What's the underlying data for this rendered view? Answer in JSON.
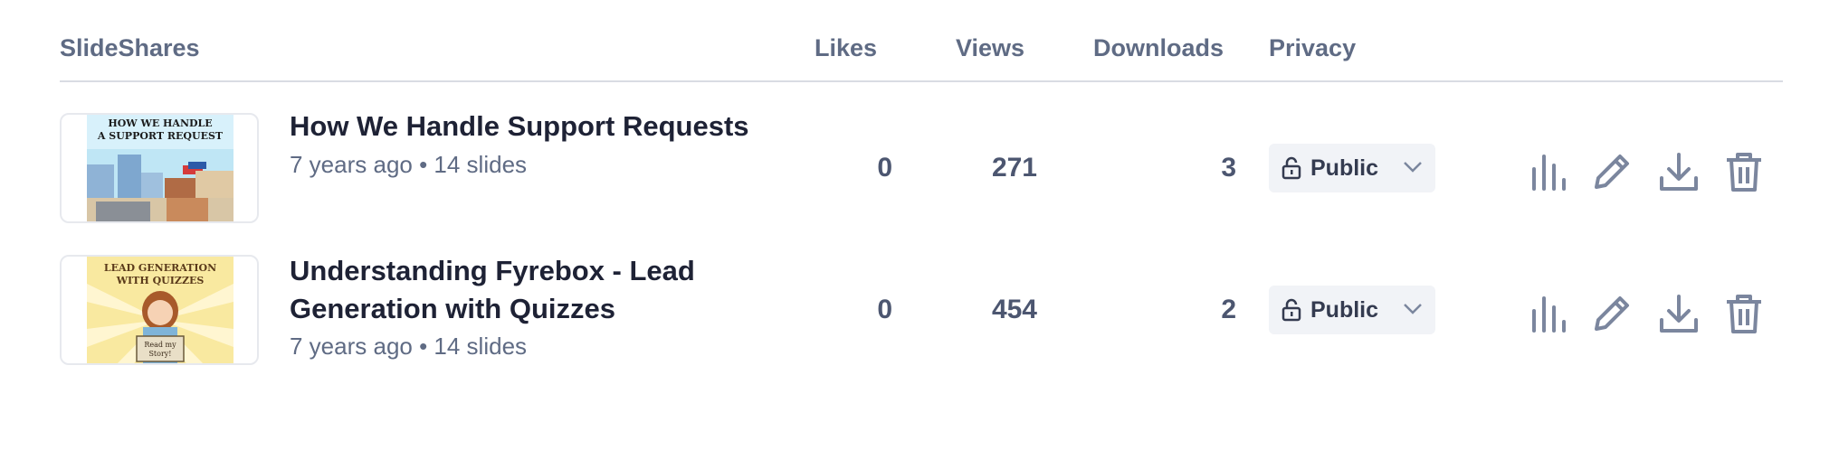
{
  "header": {
    "col_slideshares": "SlideShares",
    "col_likes": "Likes",
    "col_views": "Views",
    "col_downloads": "Downloads",
    "col_privacy": "Privacy"
  },
  "rows": [
    {
      "thumb_text": "HOW WE HANDLE A SUPPORT REQUEST",
      "title": "How We Handle Support Requests",
      "meta": "7 years ago • 14 slides",
      "likes": "0",
      "views": "271",
      "downloads": "3",
      "privacy": "Public"
    },
    {
      "thumb_text": "LEAD GENERATION WITH QUIZZES",
      "thumb_sign": "Read my Story!",
      "title": "Understanding Fyrebox - Lead Generation with Quizzes",
      "meta": "7 years ago • 14 slides",
      "likes": "0",
      "views": "454",
      "downloads": "2",
      "privacy": "Public"
    }
  ],
  "icons": {
    "privacy": "unlock-icon",
    "dropdown": "chevron-down-icon",
    "stats": "bar-chart-icon",
    "edit": "pencil-icon",
    "download": "download-icon",
    "delete": "trash-icon"
  },
  "colors": {
    "icon": "#7b869e",
    "text_primary": "#1e2235",
    "text_secondary": "#5f6b84",
    "privacy_bg": "#f1f3f7"
  }
}
